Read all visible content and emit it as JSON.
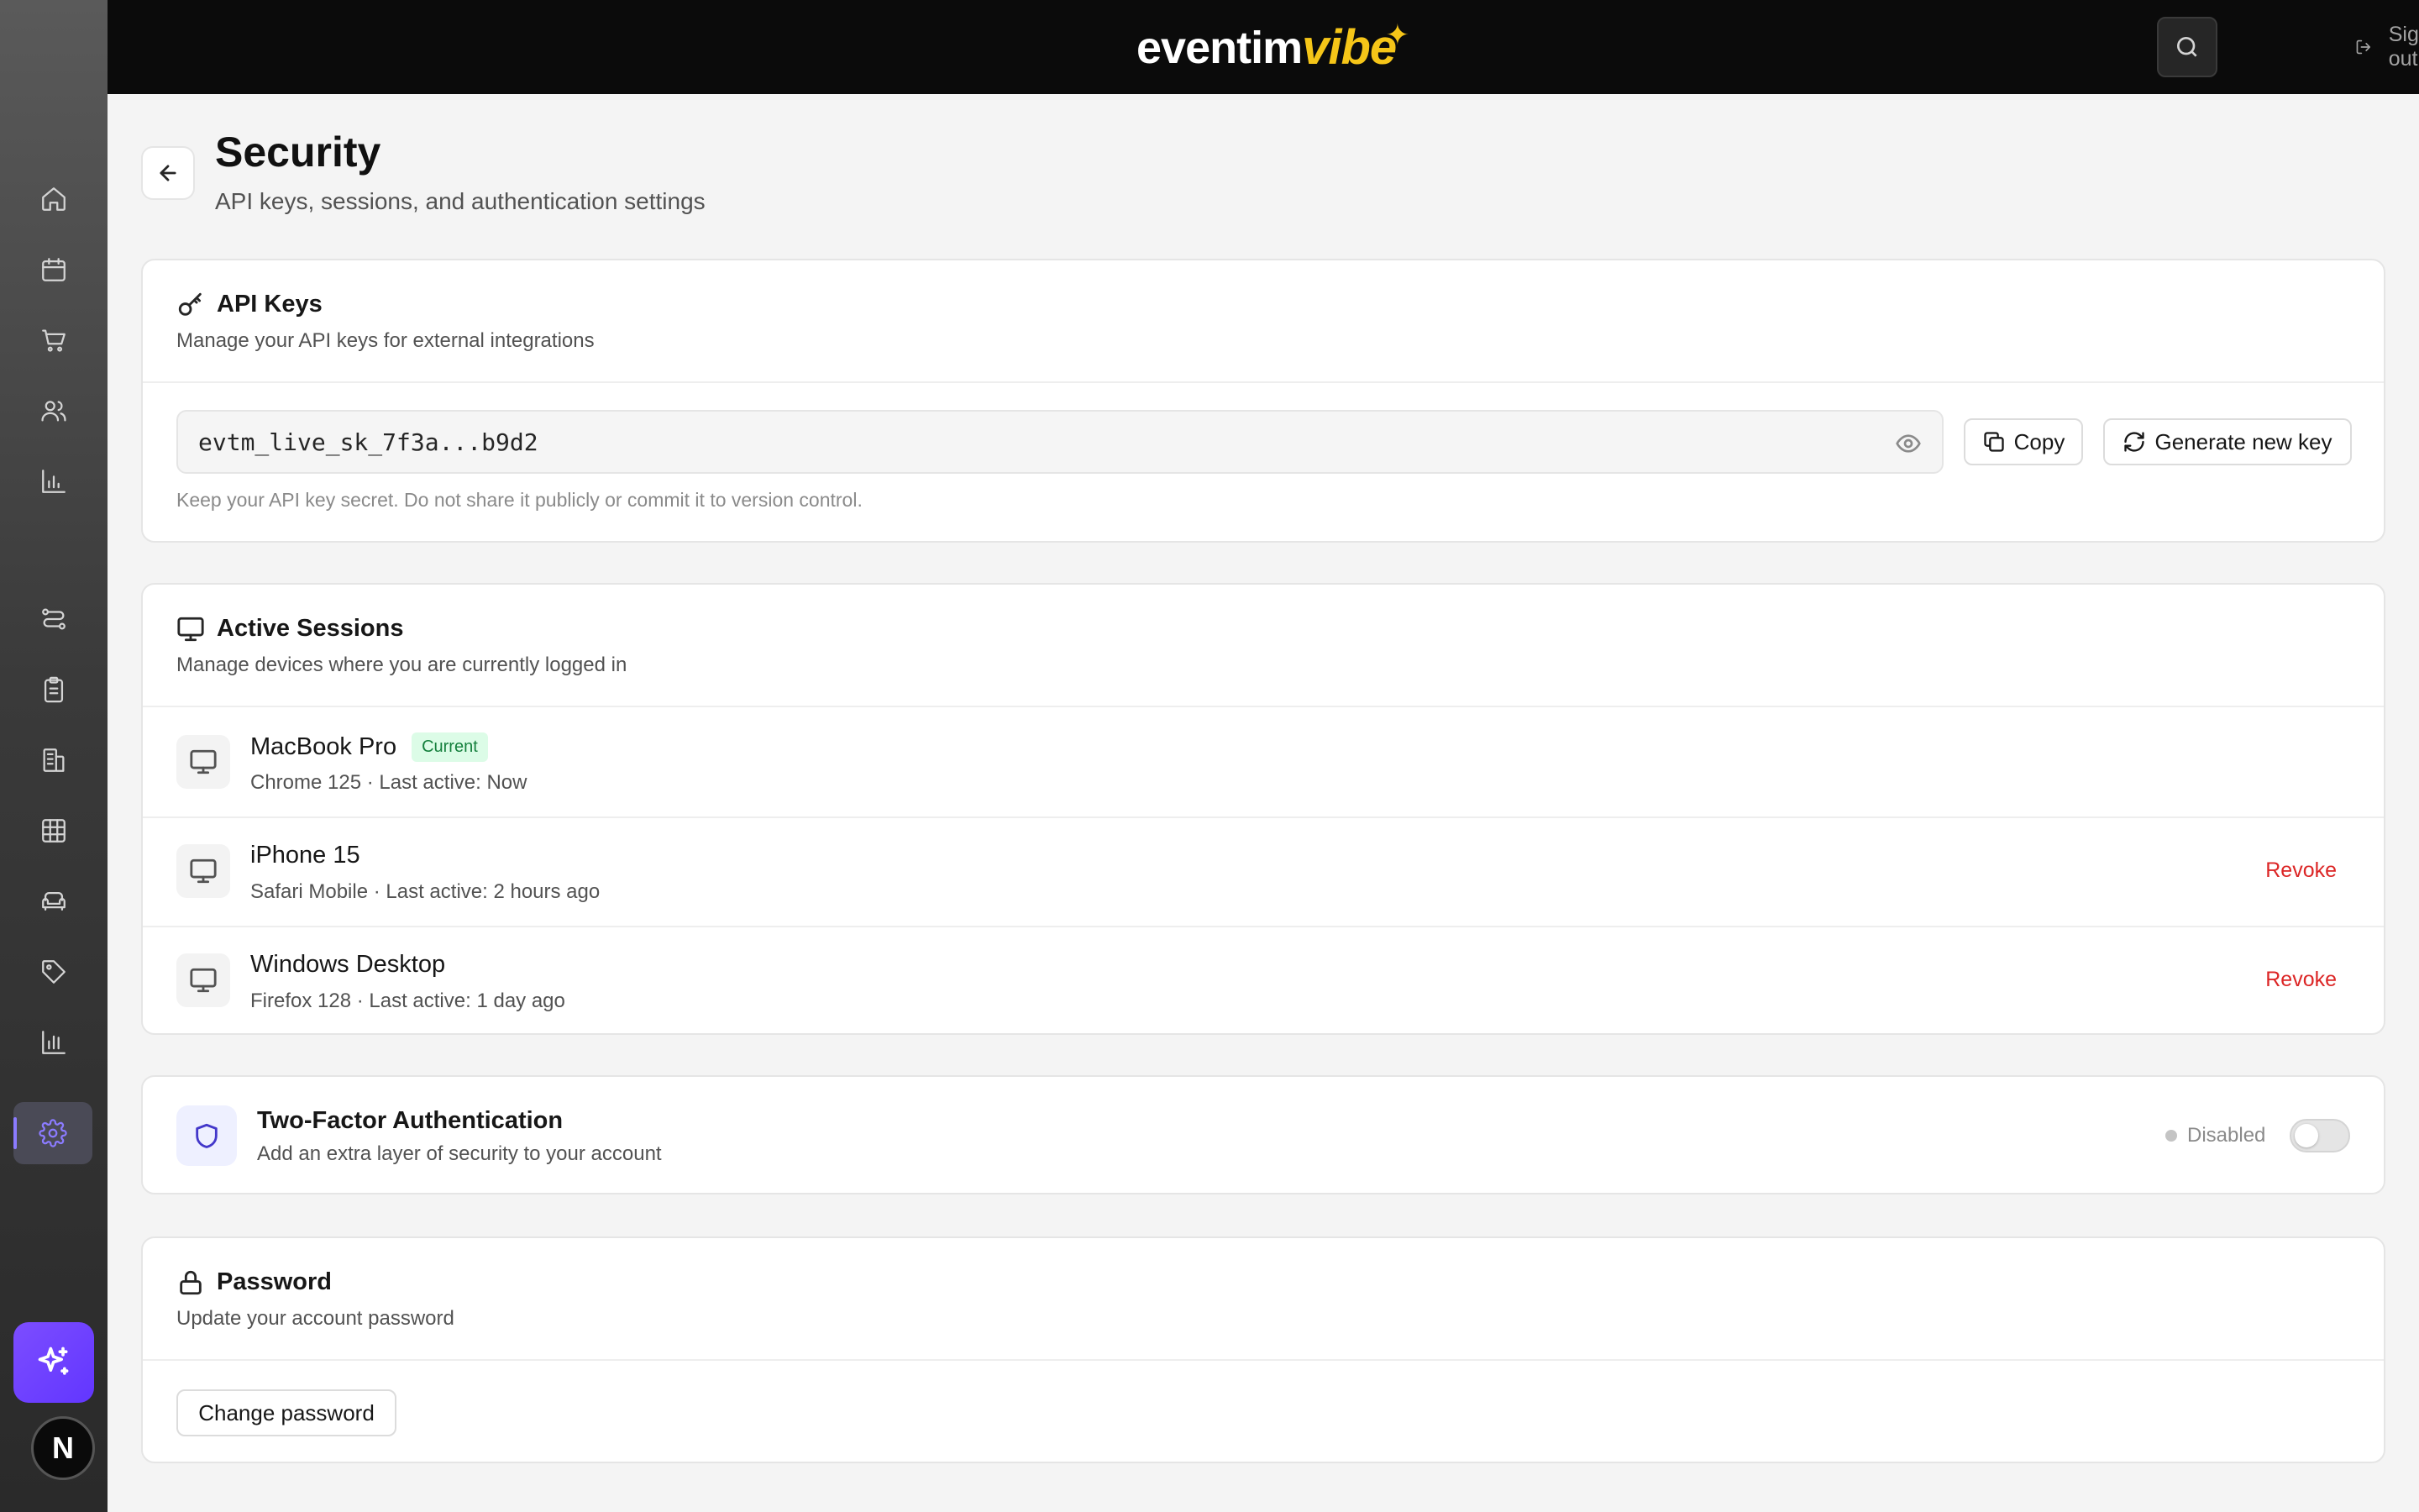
{
  "app": {
    "logo_main": "eventim",
    "logo_accent": "vibe"
  },
  "topbar": {
    "signout_label": "Sign out"
  },
  "user": {
    "avatar_initial": "N"
  },
  "page": {
    "title": "Security",
    "subtitle": "API keys, sessions, and authentication settings"
  },
  "api_keys": {
    "title": "API Keys",
    "description": "Manage your API keys for external integrations",
    "key_value": "evtm_live_sk_7f3a...b9d2",
    "copy_label": "Copy",
    "generate_label": "Generate new key",
    "hint": "Keep your API key secret. Do not share it publicly or commit it to version control."
  },
  "sessions": {
    "title": "Active Sessions",
    "description": "Manage devices where you are currently logged in",
    "items": [
      {
        "device": "MacBook Pro",
        "badge": "Current",
        "meta": "Chrome 125 · Last active: Now",
        "action": ""
      },
      {
        "device": "iPhone 15",
        "badge": "",
        "meta": "Safari Mobile · Last active: 2 hours ago",
        "action": "Revoke"
      },
      {
        "device": "Windows Desktop",
        "badge": "",
        "meta": "Firefox 128 · Last active: 1 day ago",
        "action": "Revoke"
      }
    ]
  },
  "two_factor": {
    "title": "Two-Factor Authentication",
    "description": "Add an extra layer of security to your account",
    "status": "Disabled",
    "enabled": false
  },
  "password": {
    "title": "Password",
    "description": "Update your account password",
    "change_label": "Change password"
  },
  "sidebar": {
    "icons": [
      "home-icon",
      "calendar-icon",
      "cart-icon",
      "users-icon",
      "bar-chart-icon",
      "flows-icon",
      "clipboard-icon",
      "building-icon",
      "grid-icon",
      "armchair-icon",
      "tag-icon",
      "analytics-icon",
      "settings-icon"
    ],
    "active": "settings-icon"
  },
  "colors": {
    "accent": "#7c4dff",
    "revoke": "#dc2626",
    "current_badge_bg": "#dcfce7",
    "current_badge_text": "#15803d",
    "logo_accent": "#f5c518"
  }
}
